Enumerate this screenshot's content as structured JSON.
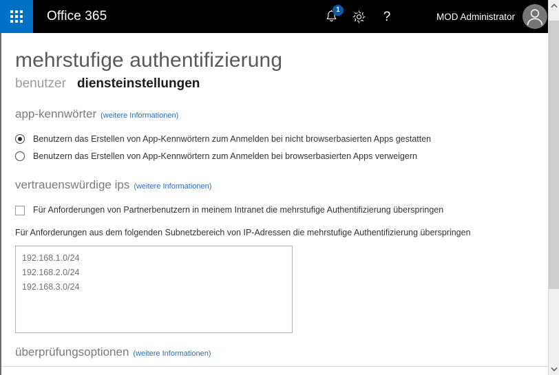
{
  "suite_bar": {
    "waffle_icon": "app-launcher-grid-icon",
    "brand": "Office 365",
    "notifications": {
      "icon": "bell-icon",
      "badge_count": "1",
      "badge_color": "#0f5ba7"
    },
    "settings_icon": "gear-icon",
    "help_icon": "question-mark-icon",
    "user_name": "MOD Administrator",
    "avatar_icon": "user-avatar-icon",
    "background_color": "#000000",
    "waffle_tile_color": "#0072c6"
  },
  "page": {
    "title": "mehrstufige authentifizierung",
    "tabs": [
      {
        "label": "benutzer",
        "active": false
      },
      {
        "label": "diensteinstellungen",
        "active": true
      }
    ],
    "more_info_label": "(weitere Informationen)",
    "link_color": "#2a6ebb",
    "sections": {
      "app_passwords": {
        "heading": "app-kennwörter",
        "options": [
          {
            "label": "Benutzern das Erstellen von App-Kennwörtern zum Anmelden bei nicht browserbasierten Apps gestatten",
            "selected": true
          },
          {
            "label": "Benutzern das Erstellen von App-Kennwörtern zum Anmelden bei browserbasierten Apps verweigern",
            "selected": false
          }
        ]
      },
      "trusted_ips": {
        "heading": "vertrauenswürdige ips",
        "checkbox": {
          "label": "Für Anforderungen von Partnerbenutzern in meinem Intranet die mehrstufige Authentifizierung überspringen",
          "checked": false
        },
        "field_label": "Für Anforderungen aus dem folgenden Subnetzbereich von IP-Adressen die mehrstufige Authentifizierung überspringen",
        "ip_ranges": [
          "192.168.1.0/24",
          "192.168.2.0/24",
          "192.168.3.0/24"
        ]
      },
      "verification_options": {
        "heading": "überprüfungsoptionen"
      }
    }
  },
  "scrollbar": {
    "up_arrow": "chevron-up-icon",
    "down_arrow": "chevron-down-icon",
    "thumb_color": "#cdcdcd"
  }
}
